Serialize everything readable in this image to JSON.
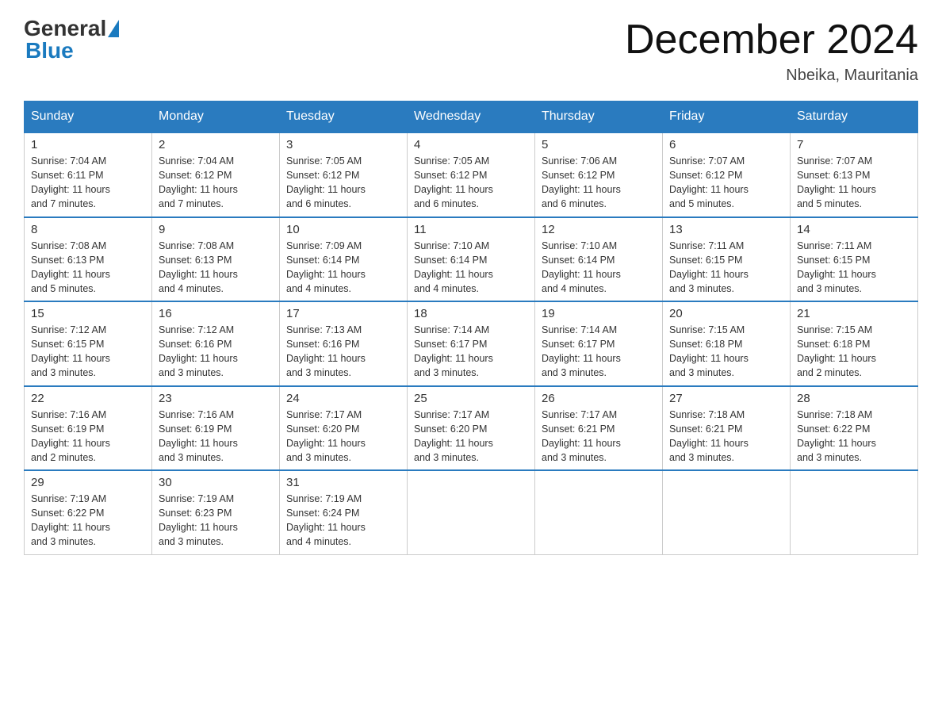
{
  "header": {
    "logo_general": "General",
    "logo_blue": "Blue",
    "month_title": "December 2024",
    "location": "Nbeika, Mauritania"
  },
  "days_of_week": [
    "Sunday",
    "Monday",
    "Tuesday",
    "Wednesday",
    "Thursday",
    "Friday",
    "Saturday"
  ],
  "weeks": [
    [
      {
        "day": "1",
        "info": "Sunrise: 7:04 AM\nSunset: 6:11 PM\nDaylight: 11 hours\nand 7 minutes."
      },
      {
        "day": "2",
        "info": "Sunrise: 7:04 AM\nSunset: 6:12 PM\nDaylight: 11 hours\nand 7 minutes."
      },
      {
        "day": "3",
        "info": "Sunrise: 7:05 AM\nSunset: 6:12 PM\nDaylight: 11 hours\nand 6 minutes."
      },
      {
        "day": "4",
        "info": "Sunrise: 7:05 AM\nSunset: 6:12 PM\nDaylight: 11 hours\nand 6 minutes."
      },
      {
        "day": "5",
        "info": "Sunrise: 7:06 AM\nSunset: 6:12 PM\nDaylight: 11 hours\nand 6 minutes."
      },
      {
        "day": "6",
        "info": "Sunrise: 7:07 AM\nSunset: 6:12 PM\nDaylight: 11 hours\nand 5 minutes."
      },
      {
        "day": "7",
        "info": "Sunrise: 7:07 AM\nSunset: 6:13 PM\nDaylight: 11 hours\nand 5 minutes."
      }
    ],
    [
      {
        "day": "8",
        "info": "Sunrise: 7:08 AM\nSunset: 6:13 PM\nDaylight: 11 hours\nand 5 minutes."
      },
      {
        "day": "9",
        "info": "Sunrise: 7:08 AM\nSunset: 6:13 PM\nDaylight: 11 hours\nand 4 minutes."
      },
      {
        "day": "10",
        "info": "Sunrise: 7:09 AM\nSunset: 6:14 PM\nDaylight: 11 hours\nand 4 minutes."
      },
      {
        "day": "11",
        "info": "Sunrise: 7:10 AM\nSunset: 6:14 PM\nDaylight: 11 hours\nand 4 minutes."
      },
      {
        "day": "12",
        "info": "Sunrise: 7:10 AM\nSunset: 6:14 PM\nDaylight: 11 hours\nand 4 minutes."
      },
      {
        "day": "13",
        "info": "Sunrise: 7:11 AM\nSunset: 6:15 PM\nDaylight: 11 hours\nand 3 minutes."
      },
      {
        "day": "14",
        "info": "Sunrise: 7:11 AM\nSunset: 6:15 PM\nDaylight: 11 hours\nand 3 minutes."
      }
    ],
    [
      {
        "day": "15",
        "info": "Sunrise: 7:12 AM\nSunset: 6:15 PM\nDaylight: 11 hours\nand 3 minutes."
      },
      {
        "day": "16",
        "info": "Sunrise: 7:12 AM\nSunset: 6:16 PM\nDaylight: 11 hours\nand 3 minutes."
      },
      {
        "day": "17",
        "info": "Sunrise: 7:13 AM\nSunset: 6:16 PM\nDaylight: 11 hours\nand 3 minutes."
      },
      {
        "day": "18",
        "info": "Sunrise: 7:14 AM\nSunset: 6:17 PM\nDaylight: 11 hours\nand 3 minutes."
      },
      {
        "day": "19",
        "info": "Sunrise: 7:14 AM\nSunset: 6:17 PM\nDaylight: 11 hours\nand 3 minutes."
      },
      {
        "day": "20",
        "info": "Sunrise: 7:15 AM\nSunset: 6:18 PM\nDaylight: 11 hours\nand 3 minutes."
      },
      {
        "day": "21",
        "info": "Sunrise: 7:15 AM\nSunset: 6:18 PM\nDaylight: 11 hours\nand 2 minutes."
      }
    ],
    [
      {
        "day": "22",
        "info": "Sunrise: 7:16 AM\nSunset: 6:19 PM\nDaylight: 11 hours\nand 2 minutes."
      },
      {
        "day": "23",
        "info": "Sunrise: 7:16 AM\nSunset: 6:19 PM\nDaylight: 11 hours\nand 3 minutes."
      },
      {
        "day": "24",
        "info": "Sunrise: 7:17 AM\nSunset: 6:20 PM\nDaylight: 11 hours\nand 3 minutes."
      },
      {
        "day": "25",
        "info": "Sunrise: 7:17 AM\nSunset: 6:20 PM\nDaylight: 11 hours\nand 3 minutes."
      },
      {
        "day": "26",
        "info": "Sunrise: 7:17 AM\nSunset: 6:21 PM\nDaylight: 11 hours\nand 3 minutes."
      },
      {
        "day": "27",
        "info": "Sunrise: 7:18 AM\nSunset: 6:21 PM\nDaylight: 11 hours\nand 3 minutes."
      },
      {
        "day": "28",
        "info": "Sunrise: 7:18 AM\nSunset: 6:22 PM\nDaylight: 11 hours\nand 3 minutes."
      }
    ],
    [
      {
        "day": "29",
        "info": "Sunrise: 7:19 AM\nSunset: 6:22 PM\nDaylight: 11 hours\nand 3 minutes."
      },
      {
        "day": "30",
        "info": "Sunrise: 7:19 AM\nSunset: 6:23 PM\nDaylight: 11 hours\nand 3 minutes."
      },
      {
        "day": "31",
        "info": "Sunrise: 7:19 AM\nSunset: 6:24 PM\nDaylight: 11 hours\nand 4 minutes."
      },
      {
        "day": "",
        "info": ""
      },
      {
        "day": "",
        "info": ""
      },
      {
        "day": "",
        "info": ""
      },
      {
        "day": "",
        "info": ""
      }
    ]
  ]
}
